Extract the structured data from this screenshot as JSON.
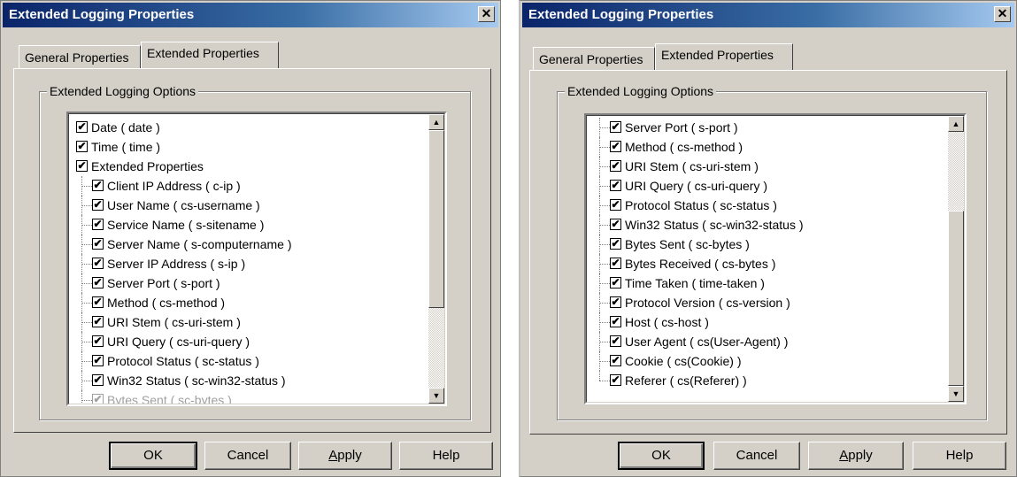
{
  "dialogs": [
    {
      "title": "Extended Logging Properties",
      "close_glyph": "✕",
      "tabs": [
        "General Properties",
        "Extended Properties"
      ],
      "active_tab": "Extended Properties",
      "group_label": "Extended Logging Options",
      "items": [
        {
          "label": "Date  ( date )",
          "checked": true,
          "level": 0
        },
        {
          "label": "Time  ( time )",
          "checked": true,
          "level": 0
        },
        {
          "label": "Extended Properties",
          "checked": true,
          "level": 0
        },
        {
          "label": "Client IP Address  ( c-ip )",
          "checked": true,
          "level": 1
        },
        {
          "label": "User Name  ( cs-username )",
          "checked": true,
          "level": 1
        },
        {
          "label": "Service Name  ( s-sitename )",
          "checked": true,
          "level": 1
        },
        {
          "label": "Server Name  ( s-computername )",
          "checked": true,
          "level": 1
        },
        {
          "label": "Server IP Address  ( s-ip )",
          "checked": true,
          "level": 1
        },
        {
          "label": "Server Port  ( s-port )",
          "checked": true,
          "level": 1
        },
        {
          "label": "Method  ( cs-method )",
          "checked": true,
          "level": 1
        },
        {
          "label": "URI Stem  ( cs-uri-stem )",
          "checked": true,
          "level": 1
        },
        {
          "label": "URI Query  ( cs-uri-query )",
          "checked": true,
          "level": 1
        },
        {
          "label": "Protocol Status  ( sc-status )",
          "checked": true,
          "level": 1
        },
        {
          "label": "Win32 Status  ( sc-win32-status )",
          "checked": true,
          "level": 1
        },
        {
          "label": "Bytes Sent  ( sc-bytes )",
          "checked": true,
          "level": 1,
          "partial": true
        }
      ],
      "scroll_position": 0.0,
      "buttons": {
        "ok": "OK",
        "cancel": "Cancel",
        "apply_mnemonic": "A",
        "apply_rest": "pply",
        "help": "Help"
      }
    },
    {
      "title": "Extended Logging Properties",
      "close_glyph": "✕",
      "tabs": [
        "General Properties",
        "Extended Properties"
      ],
      "active_tab": "Extended Properties",
      "group_label": "Extended Logging Options",
      "items": [
        {
          "label": "Server Port  ( s-port )",
          "checked": true,
          "level": 1
        },
        {
          "label": "Method  ( cs-method )",
          "checked": true,
          "level": 1
        },
        {
          "label": "URI Stem  ( cs-uri-stem )",
          "checked": true,
          "level": 1
        },
        {
          "label": "URI Query  ( cs-uri-query )",
          "checked": true,
          "level": 1
        },
        {
          "label": "Protocol Status  ( sc-status )",
          "checked": true,
          "level": 1
        },
        {
          "label": "Win32 Status  ( sc-win32-status )",
          "checked": true,
          "level": 1
        },
        {
          "label": "Bytes Sent  ( sc-bytes )",
          "checked": true,
          "level": 1
        },
        {
          "label": "Bytes Received  ( cs-bytes )",
          "checked": true,
          "level": 1
        },
        {
          "label": "Time Taken  ( time-taken )",
          "checked": true,
          "level": 1
        },
        {
          "label": "Protocol Version  ( cs-version )",
          "checked": true,
          "level": 1
        },
        {
          "label": "Host  ( cs-host )",
          "checked": true,
          "level": 1
        },
        {
          "label": "User Agent  ( cs(User-Agent) )",
          "checked": true,
          "level": 1
        },
        {
          "label": "Cookie  ( cs(Cookie) )",
          "checked": true,
          "level": 1
        },
        {
          "label": "Referer  ( cs(Referer) )",
          "checked": true,
          "level": 1,
          "last": true
        }
      ],
      "scroll_position": 1.0,
      "buttons": {
        "ok": "OK",
        "cancel": "Cancel",
        "apply_mnemonic": "A",
        "apply_rest": "pply",
        "help": "Help"
      }
    }
  ],
  "colors": {
    "dialog_bg": "#d4d0c8",
    "title_start": "#0a246a",
    "title_end": "#a6caf0"
  },
  "icons": {
    "checkmark": "✔",
    "scroll_up": "▲",
    "scroll_down": "▼"
  }
}
